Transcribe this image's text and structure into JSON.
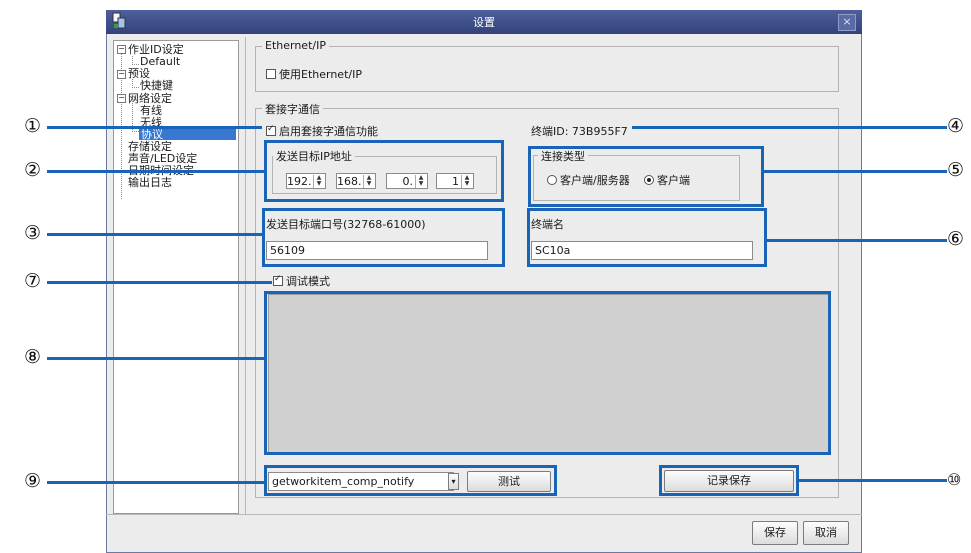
{
  "window": {
    "title": "设置",
    "close_icon": "close-icon",
    "app_icon": "app-icon"
  },
  "tree": {
    "items": [
      {
        "label": "作业ID设定"
      },
      {
        "label": "Default"
      },
      {
        "label": "预设"
      },
      {
        "label": "快捷键"
      },
      {
        "label": "网络设定"
      },
      {
        "label": "有线"
      },
      {
        "label": "无线"
      },
      {
        "label": "协议",
        "selected": true
      },
      {
        "label": "存储设定"
      },
      {
        "label": "声音/LED设定"
      },
      {
        "label": "日期时间设定"
      },
      {
        "label": "输出日志"
      }
    ]
  },
  "ethernet_ip": {
    "group_label": "Ethernet/IP",
    "checkbox_label": "使用Ethernet/IP",
    "checked": false
  },
  "socket": {
    "group_label": "套接字通信",
    "enable_label": "启用套接字通信功能",
    "enable_checked": true,
    "terminal_id_label": "终端ID:",
    "terminal_id_value": "73B955F7",
    "ip_group_label": "发送目标IP地址",
    "ip_octets": [
      "192.",
      "168.",
      "0.",
      "1"
    ],
    "conn_type_label": "连接类型",
    "conn_options": [
      "客户端/服务器",
      "客户端"
    ],
    "conn_selected": 1,
    "port_label": "发送目标端口号(32768-61000)",
    "port_value": "56109",
    "terminal_name_label": "终端名",
    "terminal_name_value": "SC10a",
    "debug_label": "调试模式",
    "debug_checked": true,
    "command_selected": "getworkitem_comp_notify",
    "test_button": "测试",
    "save_log_button": "记录保存"
  },
  "footer": {
    "save_button": "保存",
    "cancel_button": "取消"
  },
  "callouts": [
    "①",
    "②",
    "③",
    "④",
    "⑤",
    "⑥",
    "⑦",
    "⑧",
    "⑨",
    "⑩"
  ],
  "colors": {
    "annotation": "#1a64b8",
    "titlebar": "#3d4d88",
    "selection": "#3878d0"
  }
}
